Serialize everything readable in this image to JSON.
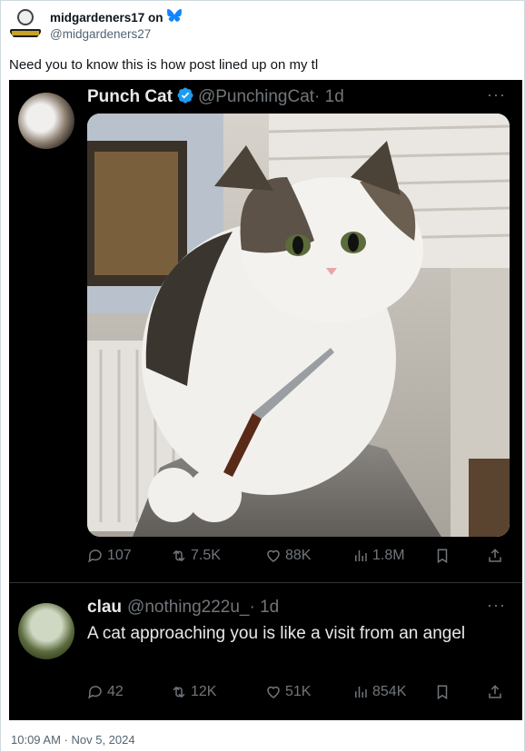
{
  "outer_post": {
    "display_name": "midgardeners17 on",
    "handle": "@midgardeners27",
    "text": "Need you to know this is how post lined up on my tl",
    "timestamp": "10:09 AM · Nov 5, 2024",
    "bluesky_color": "#1185fe"
  },
  "tweet1": {
    "name": "Punch Cat",
    "handle": "@PunchingCat",
    "age": "· 1d",
    "more": "···",
    "media_icon": "cat-holding-knife-photo",
    "stats": {
      "replies": "107",
      "reposts": "7.5K",
      "likes": "88K",
      "views": "1.8M"
    }
  },
  "tweet2": {
    "name": "clau",
    "handle": "@nothing222u_",
    "age": "· 1d",
    "more": "···",
    "text": "A cat approaching you is like a visit from an angel",
    "stats": {
      "replies": "42",
      "reposts": "12K",
      "likes": "51K",
      "views": "854K"
    }
  },
  "colors": {
    "verified": "#1d9bf0",
    "dark_bg": "#000000",
    "muted": "#71767b"
  }
}
